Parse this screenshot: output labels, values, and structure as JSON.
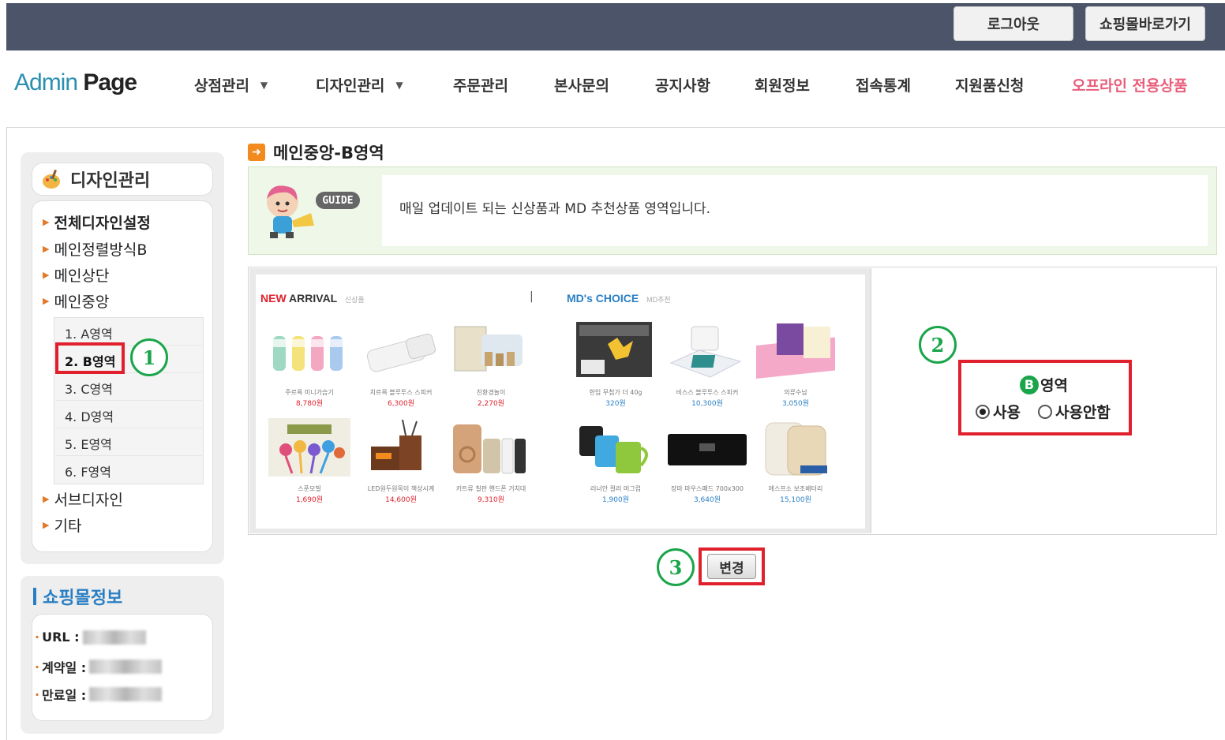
{
  "header": {
    "logout_label": "로그아웃",
    "go_shop_label": "쇼핑몰바로가기"
  },
  "logo": {
    "part1": "Admin",
    "part2": "Page"
  },
  "nav": [
    {
      "label": "상점관리",
      "dropdown": true
    },
    {
      "label": "디자인관리",
      "dropdown": true
    },
    {
      "label": "주문관리",
      "dropdown": false
    },
    {
      "label": "본사문의",
      "dropdown": false
    },
    {
      "label": "공지사항",
      "dropdown": false
    },
    {
      "label": "회원정보",
      "dropdown": false
    },
    {
      "label": "접속통계",
      "dropdown": false
    },
    {
      "label": "지원품신청",
      "dropdown": false
    },
    {
      "label": "오프라인 전용상품",
      "dropdown": false
    }
  ],
  "sidebar": {
    "title": "디자인관리",
    "items": [
      "전체디자인설정",
      "메인정렬방식B",
      "메인상단",
      "메인중앙",
      "서브디자인",
      "기타"
    ],
    "sub_items": [
      "1. A영역",
      "2. B영역",
      "3. C영역",
      "4. D영역",
      "5. E영역",
      "6. F영역"
    ],
    "selected_sub": "2. B영역"
  },
  "shop_info": {
    "title": "쇼핑몰정보",
    "url_label": "URL :",
    "contract_label": "계약일 :",
    "expire_label": "만료일 :"
  },
  "main": {
    "page_title": "메인중앙-B영역",
    "guide_badge": "GUIDE",
    "guide_text": "매일 업데이트 되는 신상품과 MD 추천상품 영역입니다.",
    "new_arrival": {
      "title_red": "NEW",
      "title": "ARRIVAL",
      "sub": "신상품"
    },
    "separator": "|",
    "md_choice": {
      "title": "MD's CHOICE",
      "sub": "MD추천"
    },
    "new_products": [
      {
        "name": "주르륵 미니가습기",
        "price": "8,780원"
      },
      {
        "name": "치르륵 블루투스 스피커",
        "price": "6,300원"
      },
      {
        "name": "친환경놀이",
        "price": "2,270원"
      },
      {
        "name": "스푼모빌",
        "price": "1,690원"
      },
      {
        "name": "LED원두원목이 책상시계",
        "price": "14,600원"
      },
      {
        "name": "키트류 칠판 핸드폰 거치대",
        "price": "9,310원"
      }
    ],
    "md_products": [
      {
        "name": "한입 무첨가 더 40g",
        "price": "320원"
      },
      {
        "name": "비스스 블루투스 스피커",
        "price": "10,300원"
      },
      {
        "name": "의류수납",
        "price": "3,050원"
      },
      {
        "name": "러너안 컬러 머그컵",
        "price": "1,900원"
      },
      {
        "name": "장마 마우스패드 700x300",
        "price": "3,640원"
      },
      {
        "name": "에스프소 보조배터리",
        "price": "15,100원"
      }
    ],
    "option": {
      "area_letter": "B",
      "area_label": "영역",
      "use_label": "사용",
      "nouse_label": "사용안함",
      "selected": "사용"
    },
    "change_button": "변경"
  },
  "markers": [
    "1",
    "2",
    "3"
  ],
  "colors": {
    "topbar": "#4b5468",
    "highlight_red": "#e0212d",
    "marker_green": "#1aa54a",
    "nav_special": "#e85d7a"
  }
}
